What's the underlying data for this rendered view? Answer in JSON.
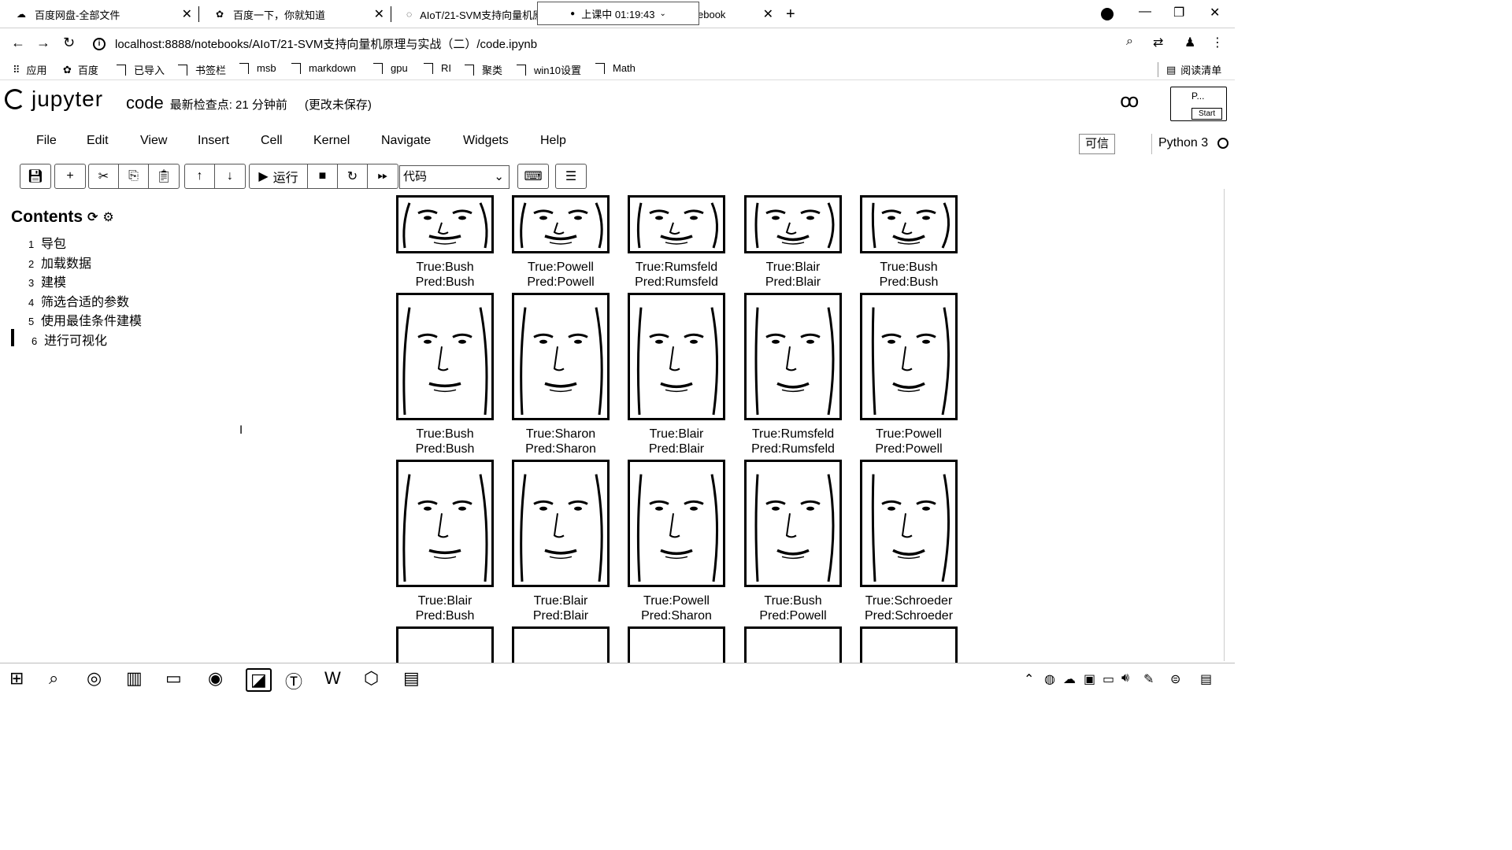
{
  "tabs": [
    {
      "title": "百度网盘-全部文件"
    },
    {
      "title": "百度一下，你就知道"
    },
    {
      "title": "AIoT/21-SVM支持向量机原"
    },
    {
      "title": "ebook"
    }
  ],
  "recording": {
    "text": "上课中 01:19:43"
  },
  "address": {
    "url": "localhost:8888/notebooks/AIoT/21-SVM支持向量机原理与实战（二）/code.ipynb"
  },
  "bookmarks": [
    "应用",
    "百度",
    "已导入",
    "书签栏",
    "msb",
    "markdown",
    "gpu",
    "RI",
    "聚类",
    "win10设置",
    "Math"
  ],
  "reading_list": "阅读清单",
  "jupyter": {
    "logo": "jupyter",
    "notebook": "code",
    "checkpoint": "最新检查点: 21 分钟前",
    "unsaved": "(更改未保存)",
    "starbox_label": "P...",
    "start_label": "Start"
  },
  "menu": [
    "File",
    "Edit",
    "View",
    "Insert",
    "Cell",
    "Kernel",
    "Navigate",
    "Widgets",
    "Help"
  ],
  "trusted": "可信",
  "kernel": "Python 3",
  "toolbar": {
    "run_label": "运行",
    "cell_type": "代码"
  },
  "toc": {
    "title": "Contents",
    "items": [
      {
        "num": "1",
        "label": "导包"
      },
      {
        "num": "2",
        "label": "加载数据"
      },
      {
        "num": "3",
        "label": "建模"
      },
      {
        "num": "4",
        "label": "筛选合适的参数"
      },
      {
        "num": "5",
        "label": "使用最佳条件建模"
      },
      {
        "num": "6",
        "label": "进行可视化"
      }
    ]
  },
  "faces": [
    [
      {
        "true": "True:Bush",
        "pred": "Pred:Bush"
      },
      {
        "true": "True:Powell",
        "pred": "Pred:Powell"
      },
      {
        "true": "True:Rumsfeld",
        "pred": "Pred:Rumsfeld"
      },
      {
        "true": "True:Blair",
        "pred": "Pred:Blair"
      },
      {
        "true": "True:Bush",
        "pred": "Pred:Bush"
      }
    ],
    [
      {
        "true": "True:Bush",
        "pred": "Pred:Bush"
      },
      {
        "true": "True:Sharon",
        "pred": "Pred:Sharon"
      },
      {
        "true": "True:Blair",
        "pred": "Pred:Blair"
      },
      {
        "true": "True:Rumsfeld",
        "pred": "Pred:Rumsfeld"
      },
      {
        "true": "True:Powell",
        "pred": "Pred:Powell"
      }
    ],
    [
      {
        "true": "True:Blair",
        "pred": "Pred:Bush"
      },
      {
        "true": "True:Blair",
        "pred": "Pred:Blair"
      },
      {
        "true": "True:Powell",
        "pred": "Pred:Sharon"
      },
      {
        "true": "True:Bush",
        "pred": "Pred:Powell"
      },
      {
        "true": "True:Schroeder",
        "pred": "Pred:Schroeder"
      }
    ]
  ]
}
